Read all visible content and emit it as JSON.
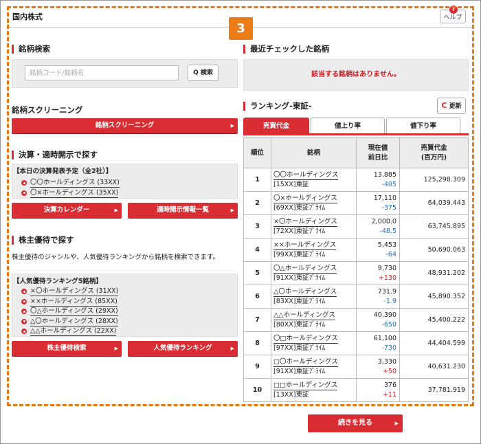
{
  "header": {
    "title": "国内株式",
    "help_label": "ヘルプ",
    "help_icon": "?"
  },
  "step_badge": "3",
  "stock_search": {
    "title": "銘柄検索",
    "placeholder": "銘柄コード/銘柄名",
    "button_label": "検索",
    "button_icon": "Q"
  },
  "screening": {
    "title": "銘柄スクリーニング",
    "button_label": "銘柄スクリーニング"
  },
  "disclosure": {
    "title": "決算・適時開示で探す",
    "today_label": "【本日の決算発表予定（全2社）】",
    "companies": [
      "〇〇ホールディングス (33XX)",
      "〇×ホールディングス (35XX)"
    ],
    "calendar_button": "決算カレンダー",
    "list_button": "適時開示情報一覧"
  },
  "yutai": {
    "title": "株主優待で探す",
    "description": "株主優待のジャンルや、人気優待ランキングから銘柄を検索できます。",
    "ranking_label": "【人気優待ランキング5銘柄】",
    "companies": [
      "×〇ホールディングス (31XX)",
      "××ホールディングス (85XX)",
      "〇△ホールディングス (29XX)",
      "△〇ホールディングス (28XX)",
      "△△ホールディングス (22XX)"
    ],
    "search_button": "株主優待検索",
    "ranking_button": "人気優待ランキング"
  },
  "recent": {
    "title": "最近チェックした銘柄",
    "empty_message": "該当する銘柄はありません。"
  },
  "ranking": {
    "title": "ランキング-東証-",
    "refresh_label": "更新",
    "refresh_icon": "C",
    "tabs": [
      "売買代金",
      "値上り率",
      "値下り率"
    ],
    "columns": {
      "rank": "順位",
      "name": "銘柄",
      "price1": "現在値",
      "price2": "前日比",
      "tv1": "売買代金",
      "tv2": "(百万円)"
    },
    "rows": [
      {
        "rank": "1",
        "name": "〇〇ホールディングス",
        "market": "[15XX]東証",
        "price": "13,885",
        "change": "-405",
        "trend": "down",
        "value": "125,298.309"
      },
      {
        "rank": "2",
        "name": "〇×ホールディングス",
        "market": "[69XX]東証ﾌﾟﾗｲﾑ",
        "price": "17,110",
        "change": "-375",
        "trend": "down",
        "value": "64,039.443"
      },
      {
        "rank": "3",
        "name": "×〇ホールディングス",
        "market": "[72XX]東証ﾌﾟﾗｲﾑ",
        "price": "2,000.0",
        "change": "-48.5",
        "trend": "down",
        "value": "63,745.895"
      },
      {
        "rank": "4",
        "name": "××ホールディングス",
        "market": "[99XX]東証ﾌﾟﾗｲﾑ",
        "price": "5,453",
        "change": "-64",
        "trend": "down",
        "value": "50,690.063"
      },
      {
        "rank": "5",
        "name": "〇△ホールディングス",
        "market": "[91XX]東証ﾌﾟﾗｲﾑ",
        "price": "9,730",
        "change": "+130",
        "trend": "up",
        "value": "48,931.202"
      },
      {
        "rank": "6",
        "name": "△〇ホールディングス",
        "market": "[83XX]東証ﾌﾟﾗｲﾑ",
        "price": "731.9",
        "change": "-1.9",
        "trend": "down",
        "value": "45,890.352"
      },
      {
        "rank": "7",
        "name": "△△ホールディングス",
        "market": "[80XX]東証ﾌﾟﾗｲﾑ",
        "price": "40,390",
        "change": "-650",
        "trend": "down",
        "value": "45,400.222"
      },
      {
        "rank": "8",
        "name": "〇□ホールディングス",
        "market": "[97XX]東証ﾌﾟﾗｲﾑ",
        "price": "61,100",
        "change": "-730",
        "trend": "down",
        "value": "44,404.599"
      },
      {
        "rank": "9",
        "name": "□〇ホールディングス",
        "market": "[91XX]東証ﾌﾟﾗｲﾑ",
        "price": "3,330",
        "change": "+50",
        "trend": "up",
        "value": "40,631.230"
      },
      {
        "rank": "10",
        "name": "□□ホールディングス",
        "market": "[13XX]東証",
        "price": "376",
        "change": "+11",
        "trend": "up",
        "value": "37,781.919"
      }
    ],
    "more_button": "続きを見る"
  },
  "arrow_glyph": "▶"
}
